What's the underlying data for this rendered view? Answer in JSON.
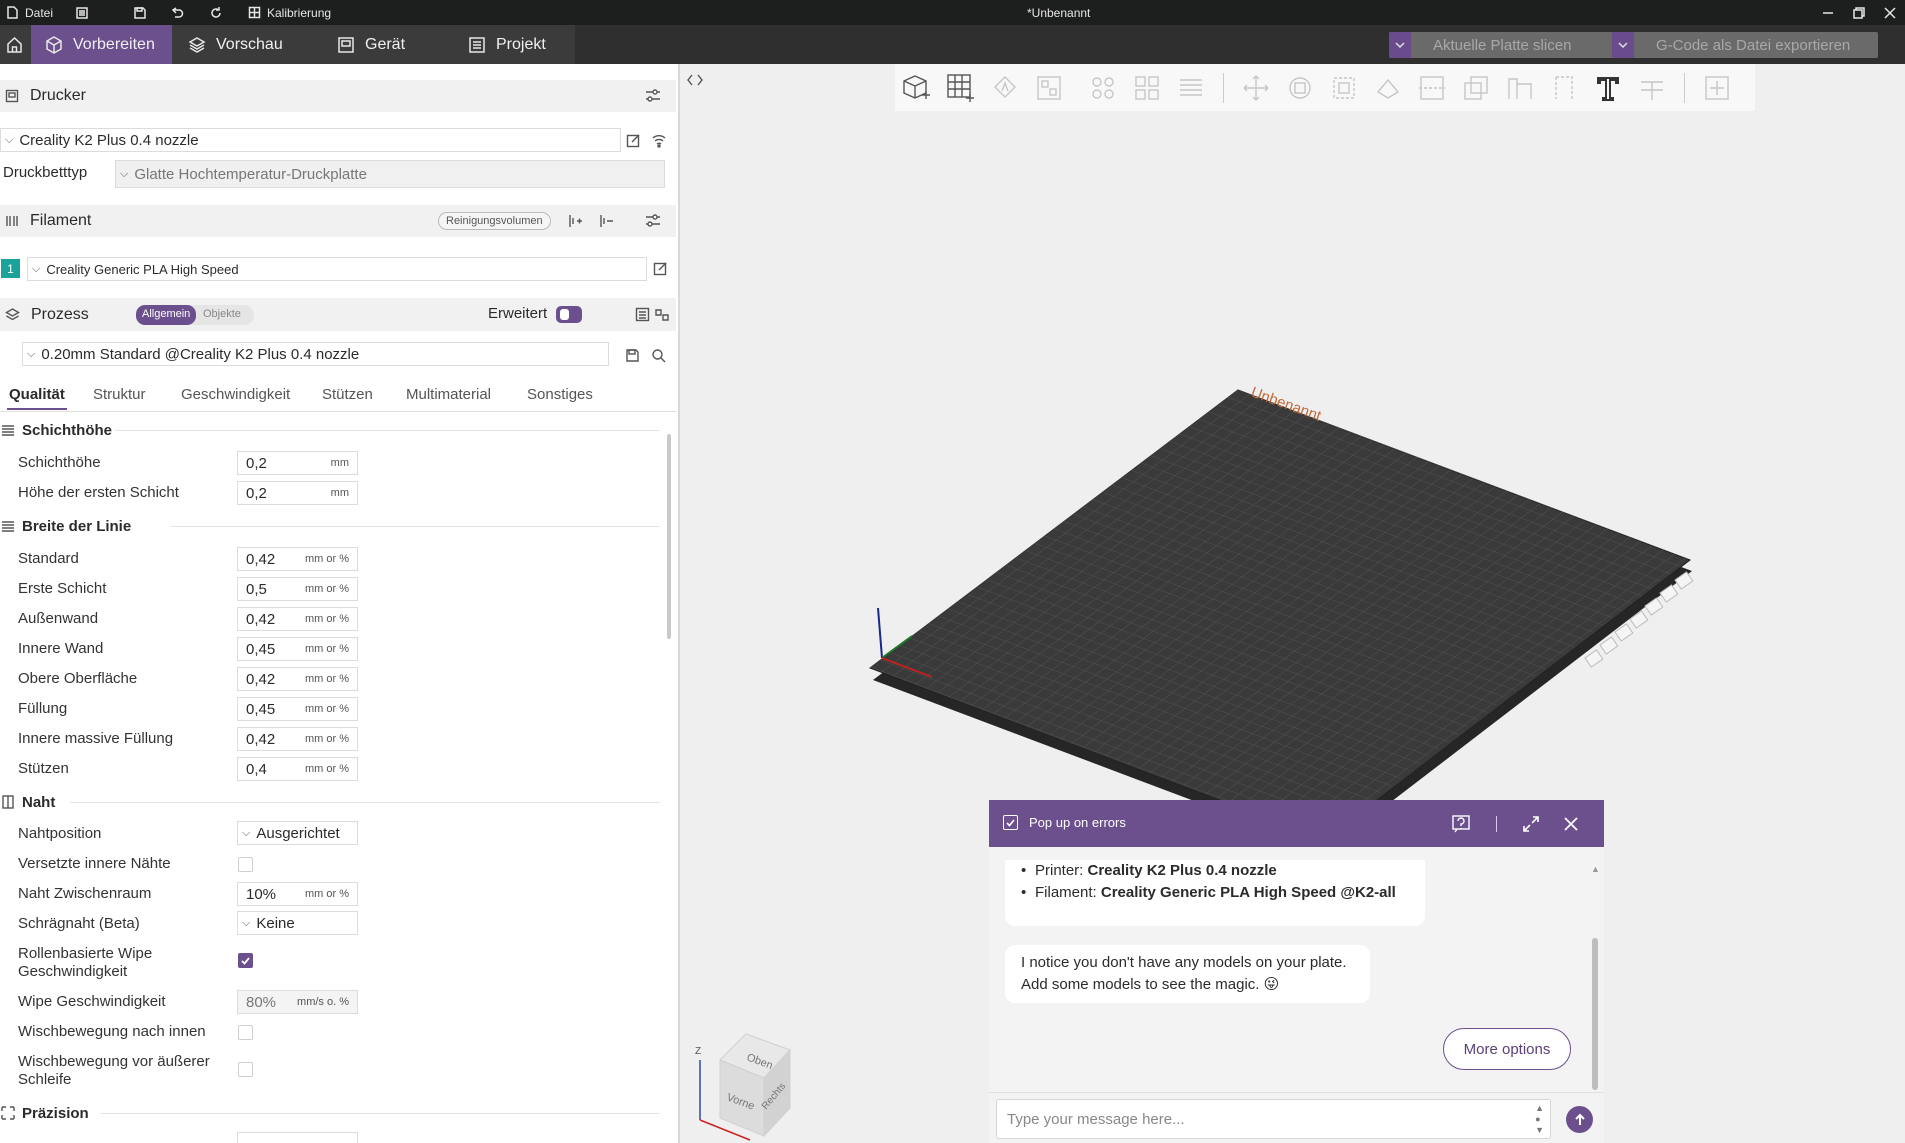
{
  "titlebar": {
    "menu_file": "Datei",
    "calibration": "Kalibrierung",
    "document_title": "*Unbenannt"
  },
  "tabs": [
    {
      "label": "Vorbereiten",
      "icon": "cube-icon",
      "active": true
    },
    {
      "label": "Vorschau",
      "icon": "layers-icon"
    },
    {
      "label": "Gerät",
      "icon": "device-icon"
    },
    {
      "label": "Projekt",
      "icon": "project-icon"
    }
  ],
  "actions": {
    "slice_label": "Aktuelle Platte slicen",
    "export_label": "G-Code als Datei exportieren"
  },
  "printer": {
    "section_title": "Drucker",
    "printer_name": "Creality K2 Plus 0.4 nozzle",
    "bed_type_label": "Druckbetttyp",
    "bed_type_value": "Glatte Hochtemperatur-Druckplatte"
  },
  "filament": {
    "section_title": "Filament",
    "flush_button": "Reinigungsvolumen",
    "slot_number": "1",
    "slot_color": "#1aa39a",
    "filament_name": "Creality Generic PLA High Speed"
  },
  "process": {
    "section_title": "Prozess",
    "toggle_general": "Allgemein",
    "toggle_objects": "Objekte",
    "advanced_label": "Erweitert",
    "preset_name": "0.20mm Standard @Creality K2 Plus 0.4 nozzle"
  },
  "subtabs": [
    "Qualität",
    "Struktur",
    "Geschwindigkeit",
    "Stützen",
    "Multimaterial",
    "Sonstiges"
  ],
  "groups": {
    "layer_height": {
      "title": "Schichthöhe",
      "rows": [
        {
          "label": "Schichthöhe",
          "value": "0,2",
          "unit": "mm"
        },
        {
          "label": "Höhe der ersten Schicht",
          "value": "0,2",
          "unit": "mm"
        }
      ]
    },
    "line_width": {
      "title": "Breite der Linie",
      "rows": [
        {
          "label": "Standard",
          "value": "0,42",
          "unit": "mm or %"
        },
        {
          "label": "Erste Schicht",
          "value": "0,5",
          "unit": "mm or %"
        },
        {
          "label": "Außenwand",
          "value": "0,42",
          "unit": "mm or %"
        },
        {
          "label": "Innere Wand",
          "value": "0,45",
          "unit": "mm or %"
        },
        {
          "label": "Obere Oberfläche",
          "value": "0,42",
          "unit": "mm or %"
        },
        {
          "label": "Füllung",
          "value": "0,45",
          "unit": "mm or %"
        },
        {
          "label": "Innere massive Füllung",
          "value": "0,42",
          "unit": "mm or %"
        },
        {
          "label": "Stützen",
          "value": "0,4",
          "unit": "mm or %"
        }
      ]
    },
    "seam": {
      "title": "Naht",
      "position_label": "Nahtposition",
      "position_value": "Ausgerichtet",
      "staggered_label": "Versetzte innere Nähte",
      "gap_label": "Naht Zwischenraum",
      "gap_value": "10%",
      "gap_unit": "mm or %",
      "scarf_label": "Schrägnaht (Beta)",
      "scarf_value": "Keine",
      "roll_wipe_label_1": "Rollenbasierte Wipe",
      "roll_wipe_label_2": "Geschwindigkeit",
      "wipe_speed_label": "Wipe Geschwindigkeit",
      "wipe_speed_value": "80%",
      "wipe_speed_unit": "mm/s o. %",
      "wipe_inward_label": "Wischbewegung nach innen",
      "wipe_outer_label_1": "Wischbewegung vor äußerer",
      "wipe_outer_label_2": "Schleife"
    },
    "precision": {
      "title": "Präzision"
    }
  },
  "viewport": {
    "plate_name": "Unbenannt",
    "cube_top": "Oben",
    "cube_front": "Vorne",
    "cube_right": "Rechts",
    "axis_z": "Z"
  },
  "chat": {
    "popup_label": "Pop up on errors",
    "printer_prefix": "Printer: ",
    "printer_value": "Creality K2 Plus 0.4 nozzle",
    "filament_prefix": "Filament: ",
    "filament_value": "Creality Generic PLA High Speed @K2-all",
    "message_line1": "I notice you don't have any models on your plate.",
    "message_line2": "Add some models to see the magic.",
    "emoji": "😜",
    "more_options": "More options",
    "input_placeholder": "Type your message here..."
  },
  "colors": {
    "accent": "#6c4f8d",
    "tabbar": "#3b3b3b",
    "titlebar": "#1d1f1e",
    "plate": "#3a3a3a"
  }
}
